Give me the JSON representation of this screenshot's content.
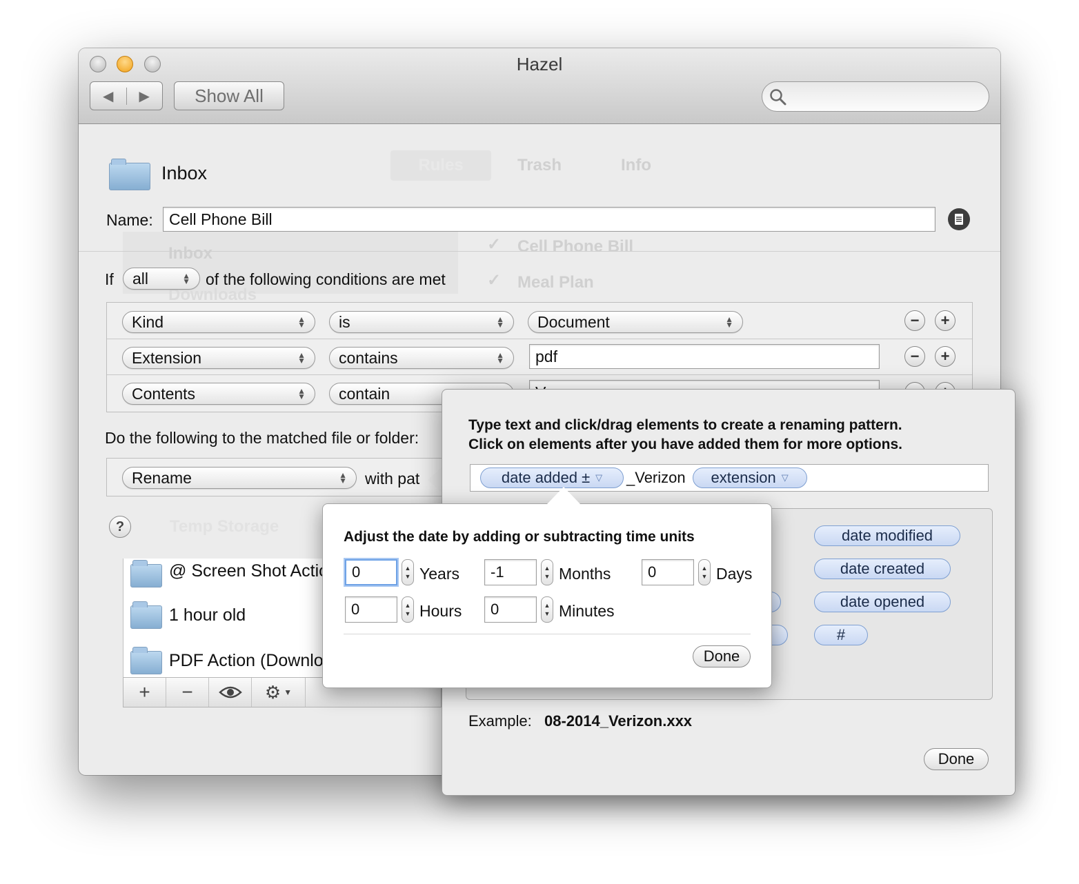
{
  "window": {
    "title": "Hazel",
    "show_all": "Show All",
    "back": "◀",
    "forward": "▶"
  },
  "ghost": {
    "tab1": "Rules",
    "tab2": "Trash",
    "tab3": "Info",
    "rule1": "Cell Phone Bill",
    "rule2": "Meal Plan",
    "folder1": "Inbox",
    "folder2": "Downloads",
    "folder3": "Temp Storage"
  },
  "header": {
    "folder_name": "Inbox"
  },
  "name_field": {
    "label": "Name:",
    "value": "Cell Phone Bill"
  },
  "conditions": {
    "if_label": "If",
    "match_value": "all",
    "suffix": "of the following conditions are met",
    "rows": [
      {
        "attribute": "Kind",
        "operator": "is",
        "value": "Document"
      },
      {
        "attribute": "Extension",
        "operator": "contains",
        "value": "pdf"
      },
      {
        "attribute": "Contents",
        "operator": "contain",
        "value": "V"
      }
    ]
  },
  "actions": {
    "label": "Do the following to the matched file or folder:",
    "action": "Rename",
    "with_label": "with pat"
  },
  "folders_list": {
    "items": [
      "@ Screen Shot Actio",
      "1 hour old",
      "PDF Action (Downlo"
    ],
    "toolbar": {
      "add": "+",
      "remove": "−",
      "eye": "👁",
      "gear": "⚙"
    }
  },
  "rename_sheet": {
    "instructions_line1": "Type text and click/drag elements to create a renaming pattern.",
    "instructions_line2": "Click on elements after you have added them for more options.",
    "pattern": {
      "token1": "date added ±",
      "text": "_Verizon",
      "token2": "extension"
    },
    "elements": [
      "date modified",
      "date created",
      "date opened",
      "#"
    ],
    "example_label": "Example:",
    "example_value": "08-2014_Verizon.xxx",
    "done": "Done"
  },
  "date_popover": {
    "title": "Adjust the date by adding or subtracting time units",
    "years": {
      "value": "0",
      "label": "Years"
    },
    "months": {
      "value": "-1",
      "label": "Months"
    },
    "days": {
      "value": "0",
      "label": "Days"
    },
    "hours": {
      "value": "0",
      "label": "Hours"
    },
    "minutes": {
      "value": "0",
      "label": "Minutes"
    },
    "done": "Done"
  }
}
